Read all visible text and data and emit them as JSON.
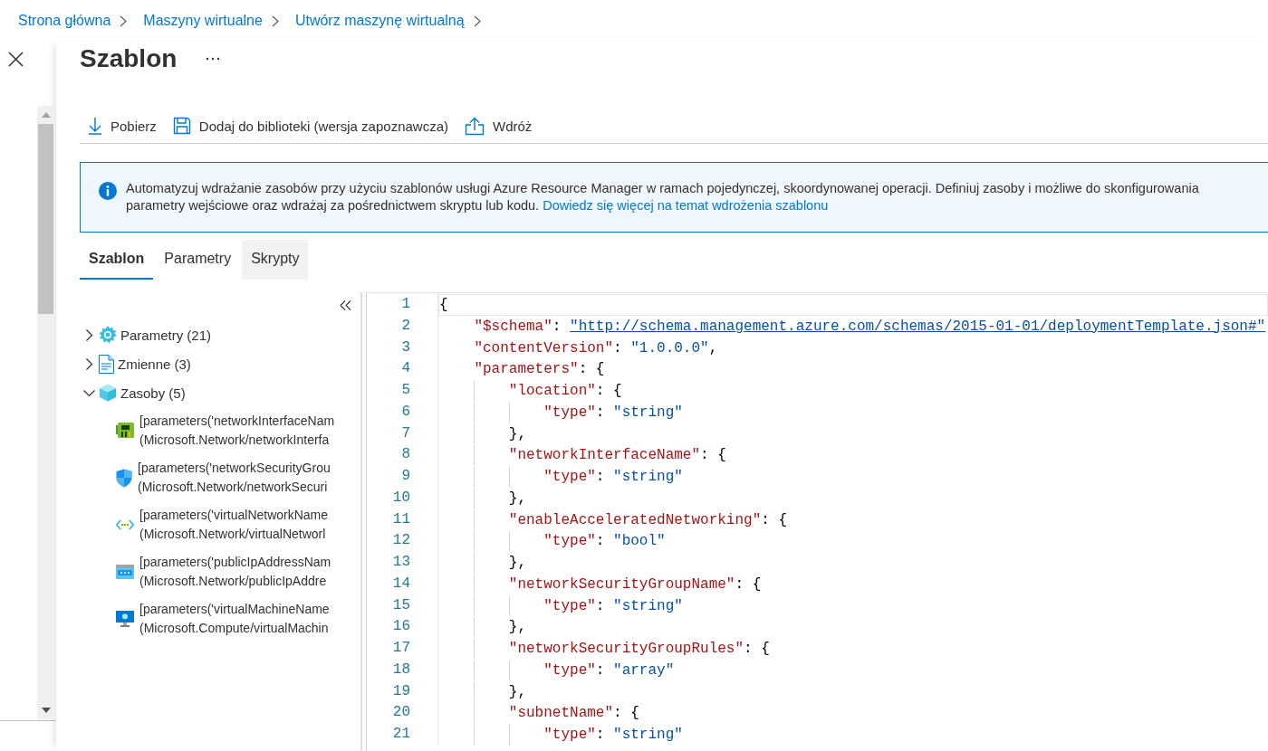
{
  "breadcrumb": [
    {
      "label": "Strona główna"
    },
    {
      "label": "Maszyny wirtualne"
    },
    {
      "label": "Utwórz maszynę wirtualną"
    }
  ],
  "title": "Szablon",
  "toolbar": [
    {
      "label": "Pobierz",
      "kind": "download"
    },
    {
      "label": "Dodaj do biblioteki (wersja zapoznawcza)",
      "kind": "save"
    },
    {
      "label": "Wdróż",
      "kind": "upload"
    }
  ],
  "info": {
    "text": "Automatyzuj wdrażanie zasobów przy użyciu szablonów usługi Azure Resource Manager w ramach pojedynczej, skoordynowanej operacji. Definiuj zasoby i możliwe do skonfigurowania parametry wejściowe oraz wdrażaj za pośrednictwem skryptu lub kodu.",
    "link": "Dowiedz się więcej na temat wdrożenia szablonu"
  },
  "tabs": [
    {
      "label": "Szablon",
      "selected": true,
      "hovered": false
    },
    {
      "label": "Parametry",
      "selected": false,
      "hovered": false
    },
    {
      "label": "Skrypty",
      "selected": false,
      "hovered": true
    }
  ],
  "tree": [
    {
      "label": "Parametry (21)",
      "kind": "gear",
      "expanded": false
    },
    {
      "label": "Zmienne (3)",
      "kind": "document",
      "expanded": false
    },
    {
      "label": "Zasoby (5)",
      "kind": "cube",
      "expanded": true,
      "children": [
        {
          "kind": "card",
          "line1": "[parameters('networkInterfaceNam",
          "line2": "(Microsoft.Network/networkInterfa"
        },
        {
          "kind": "shield",
          "line1": "[parameters('networkSecurityGrou",
          "line2": "(Microsoft.Network/networkSecuri"
        },
        {
          "kind": "network",
          "line1": "[parameters('virtualNetworkName",
          "line2": "(Microsoft.Network/virtualNetworl"
        },
        {
          "kind": "address",
          "line1": "[parameters('publicIpAddressNam",
          "line2": "(Microsoft.Network/publicIpAddre"
        },
        {
          "kind": "monitor",
          "line1": "[parameters('virtualMachineName",
          "line2": "(Microsoft.Compute/virtualMachin"
        }
      ]
    }
  ],
  "editor": {
    "lines": [
      {
        "number": "1",
        "current": true,
        "tokens": [
          {
            "kind": "punct",
            "text": "{"
          }
        ]
      },
      {
        "number": "2",
        "current": false,
        "tokens": [
          {
            "kind": "key",
            "text": "    \"$schema\""
          },
          {
            "kind": "punct",
            "text": ": "
          },
          {
            "kind": "link",
            "text": "\"http://schema.management.azure.com/schemas/2015-01-01/deploymentTemplate.json#\""
          }
        ]
      },
      {
        "number": "3",
        "current": false,
        "tokens": [
          {
            "kind": "key",
            "text": "    \"contentVersion\""
          },
          {
            "kind": "punct",
            "text": ": "
          },
          {
            "kind": "string",
            "text": "\"1.0.0.0\""
          },
          {
            "kind": "punct",
            "text": ","
          }
        ]
      },
      {
        "number": "4",
        "current": false,
        "tokens": [
          {
            "kind": "key",
            "text": "    \"parameters\""
          },
          {
            "kind": "punct",
            "text": ": {"
          }
        ]
      },
      {
        "number": "5",
        "current": false,
        "tokens": [
          {
            "kind": "key",
            "text": "        \"location\""
          },
          {
            "kind": "punct",
            "text": ": {"
          }
        ]
      },
      {
        "number": "6",
        "current": false,
        "tokens": [
          {
            "kind": "key",
            "text": "            \"type\""
          },
          {
            "kind": "punct",
            "text": ": "
          },
          {
            "kind": "string",
            "text": "\"string\""
          }
        ]
      },
      {
        "number": "7",
        "current": false,
        "tokens": [
          {
            "kind": "punct",
            "text": "        },"
          }
        ]
      },
      {
        "number": "8",
        "current": false,
        "tokens": [
          {
            "kind": "key",
            "text": "        \"networkInterfaceName\""
          },
          {
            "kind": "punct",
            "text": ": {"
          }
        ]
      },
      {
        "number": "9",
        "current": false,
        "tokens": [
          {
            "kind": "key",
            "text": "            \"type\""
          },
          {
            "kind": "punct",
            "text": ": "
          },
          {
            "kind": "string",
            "text": "\"string\""
          }
        ]
      },
      {
        "number": "10",
        "current": false,
        "tokens": [
          {
            "kind": "punct",
            "text": "        },"
          }
        ]
      },
      {
        "number": "11",
        "current": false,
        "tokens": [
          {
            "kind": "key",
            "text": "        \"enableAcceleratedNetworking\""
          },
          {
            "kind": "punct",
            "text": ": {"
          }
        ]
      },
      {
        "number": "12",
        "current": false,
        "tokens": [
          {
            "kind": "key",
            "text": "            \"type\""
          },
          {
            "kind": "punct",
            "text": ": "
          },
          {
            "kind": "string",
            "text": "\"bool\""
          }
        ]
      },
      {
        "number": "13",
        "current": false,
        "tokens": [
          {
            "kind": "punct",
            "text": "        },"
          }
        ]
      },
      {
        "number": "14",
        "current": false,
        "tokens": [
          {
            "kind": "key",
            "text": "        \"networkSecurityGroupName\""
          },
          {
            "kind": "punct",
            "text": ": {"
          }
        ]
      },
      {
        "number": "15",
        "current": false,
        "tokens": [
          {
            "kind": "key",
            "text": "            \"type\""
          },
          {
            "kind": "punct",
            "text": ": "
          },
          {
            "kind": "string",
            "text": "\"string\""
          }
        ]
      },
      {
        "number": "16",
        "current": false,
        "tokens": [
          {
            "kind": "punct",
            "text": "        },"
          }
        ]
      },
      {
        "number": "17",
        "current": false,
        "tokens": [
          {
            "kind": "key",
            "text": "        \"networkSecurityGroupRules\""
          },
          {
            "kind": "punct",
            "text": ": {"
          }
        ]
      },
      {
        "number": "18",
        "current": false,
        "tokens": [
          {
            "kind": "key",
            "text": "            \"type\""
          },
          {
            "kind": "punct",
            "text": ": "
          },
          {
            "kind": "string",
            "text": "\"array\""
          }
        ]
      },
      {
        "number": "19",
        "current": false,
        "tokens": [
          {
            "kind": "punct",
            "text": "        },"
          }
        ]
      },
      {
        "number": "20",
        "current": false,
        "tokens": [
          {
            "kind": "key",
            "text": "        \"subnetName\""
          },
          {
            "kind": "punct",
            "text": ": {"
          }
        ]
      },
      {
        "number": "21",
        "current": false,
        "tokens": [
          {
            "kind": "key",
            "text": "            \"type\""
          },
          {
            "kind": "punct",
            "text": ": "
          },
          {
            "kind": "string",
            "text": "\"string\""
          }
        ]
      }
    ]
  }
}
